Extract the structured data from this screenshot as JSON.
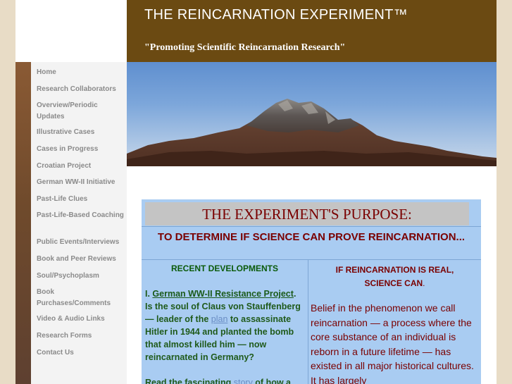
{
  "header": {
    "title": "THE REINCARNATION EXPERIMENT™",
    "tagline": "\"Promoting Scientific Reincarnation Research\""
  },
  "sidebar": {
    "items": [
      {
        "label": "Home"
      },
      {
        "label": "Research Collaborators"
      },
      {
        "label": "Overview/Periodic Updates"
      },
      {
        "label": "Illustrative Cases"
      },
      {
        "label": "Cases in Progress"
      },
      {
        "label": "Croatian Project"
      },
      {
        "label": "German WW-II Initiative"
      },
      {
        "label": "Past-Life Clues"
      },
      {
        "label": "Past-Life-Based Coaching"
      },
      {
        "label": "Public Events/Interviews"
      },
      {
        "label": "Book and Peer Reviews"
      },
      {
        "label": "Soul/Psychoplasm"
      },
      {
        "label": "Book Purchases/Comments"
      },
      {
        "label": "Video & Audio Links"
      },
      {
        "label": "Research Forms"
      },
      {
        "label": "Contact Us"
      }
    ]
  },
  "banner": {
    "icon": "mountain-landscape-image"
  },
  "main": {
    "purpose_heading": "THE EXPERIMENT'S PURPOSE:",
    "purpose_sub": "TO DETERMINE IF SCIENCE CAN PROVE REINCARNATION...",
    "recent_heading": "RECENT DEVELOPMENTS",
    "recent": {
      "prefix": "I. ",
      "project_link": "German WW-II Resistance Project",
      "after_link": ". Is the soul of Claus von Stauffenberg — leader of the ",
      "plan_link": "plan",
      "rest": " to assassinate Hitler in 1944 and planted the bomb that almost killed him — now reincarnated in Germany?",
      "read_prefix": "Read the fascinating ",
      "story_link": "story",
      "read_suffix": " of how a"
    },
    "real_heading": {
      "line1": "IF REINCARNATION IS REAL,",
      "line2": "SCIENCE CAN",
      "period": "."
    },
    "right_text": "Belief in the phenomenon we call reincarnation — a process where the core substance of an individual is reborn in a future lifetime — has existed in all major historical cultures. It has largely"
  },
  "colors": {
    "header_bg": "#6b4a12",
    "heading_red": "#7a0000",
    "link_green": "#1f5a1a",
    "content_bg": "#a9ccf2"
  }
}
